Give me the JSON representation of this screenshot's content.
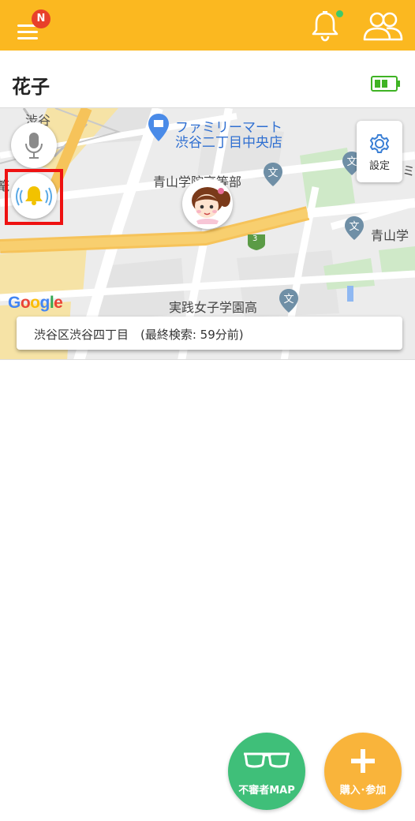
{
  "header": {
    "menu_icon": "hamburger-icon",
    "badge": "N",
    "bell_icon": "bell-icon",
    "users_icon": "users-icon",
    "accent_color": "#fbb820"
  },
  "child": {
    "name": "花子",
    "battery_icon": "battery-icon",
    "battery_color": "#3fb324"
  },
  "map": {
    "labels": {
      "shibuya": "渋谷",
      "familymart_line1": "ファミリーマート",
      "familymart_line2": "渋谷二丁目中央店",
      "aoyama_hs": "青山学院高等部",
      "aoyama_right": "青山学",
      "right_cut": "ミ",
      "jissen": "実践女子学園高",
      "route": "3",
      "left_cut": "篭"
    },
    "google": [
      "G",
      "o",
      "o",
      "g",
      "l",
      "e"
    ],
    "google_colors": [
      "#4285f4",
      "#ea4335",
      "#fbbc05",
      "#4285f4",
      "#34a853",
      "#ea4335"
    ],
    "settings_label": "設定",
    "mic_icon": "microphone-icon",
    "alarm_icon": "alarm-bell-icon",
    "address": "渋谷区渋谷四丁目　(最終検索: 59分前)"
  },
  "actions": {
    "suspicious_map_label": "不審者MAP",
    "buy_label": "購入･参加",
    "suspicious_color": "#3fbf79",
    "buy_color": "#f9b43b"
  }
}
